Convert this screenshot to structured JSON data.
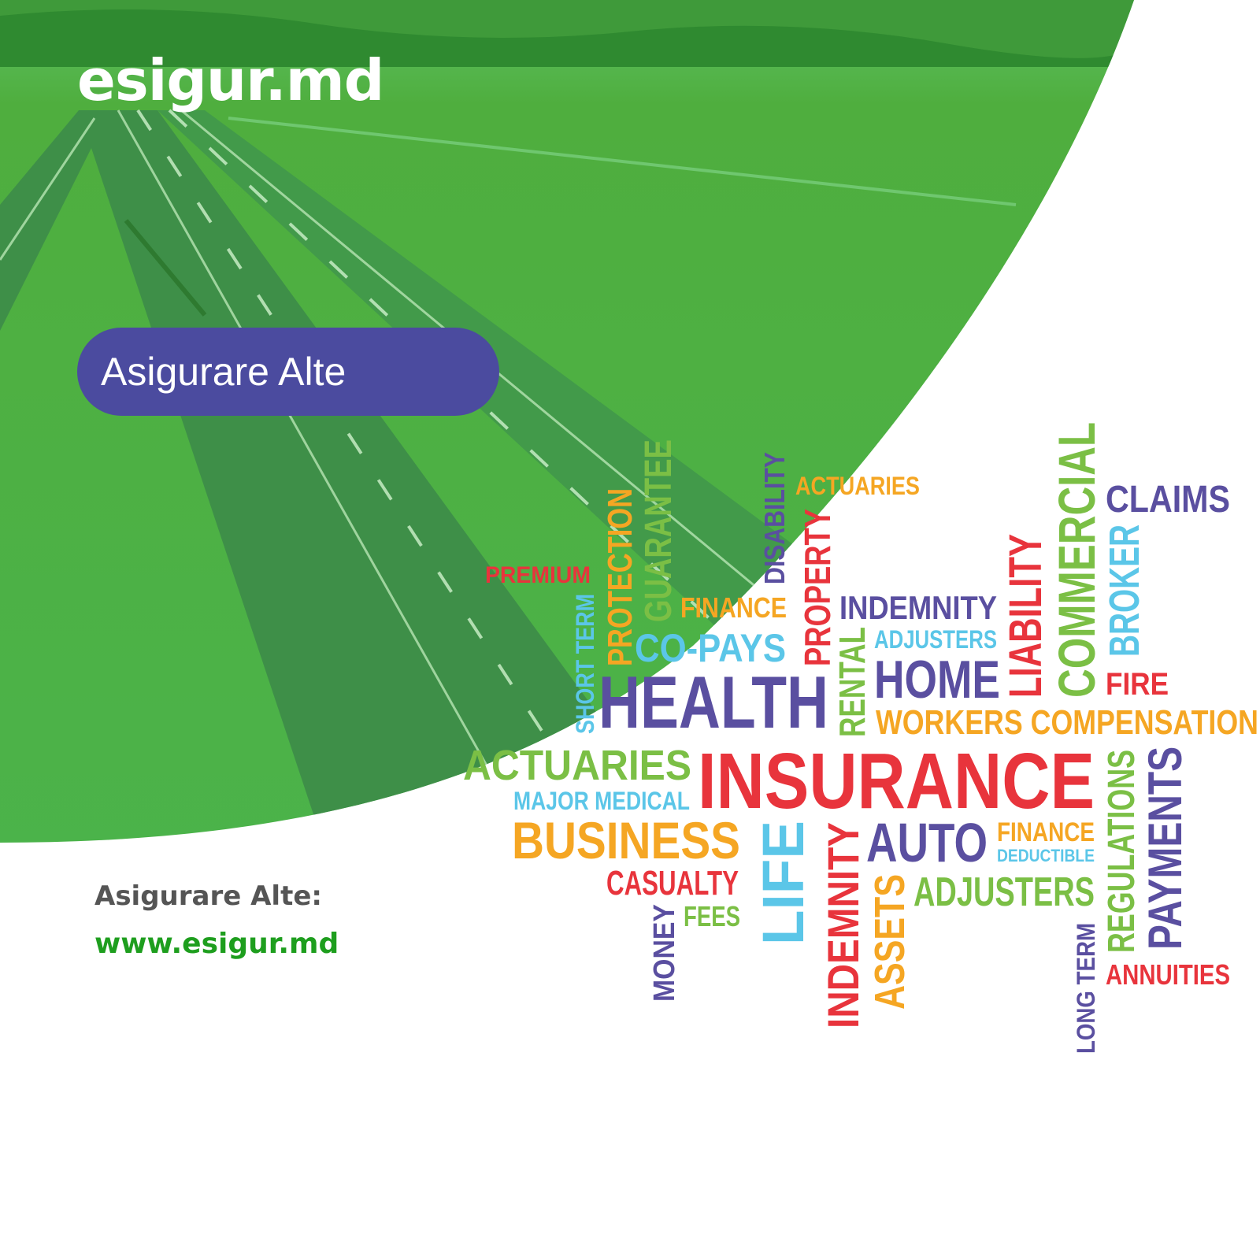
{
  "brand": {
    "logo_text": "esigur.md"
  },
  "banner": {
    "pill_text": "Asigurare Alte"
  },
  "footer": {
    "label": "Asigurare Alte:",
    "url": "www.esigur.md"
  },
  "colors": {
    "green_overlay": "#4CB84C",
    "pill": "#4B4B9F",
    "url_green": "#1E9E1E",
    "label_gray": "#555555"
  },
  "word_cloud": {
    "words": [
      {
        "text": "PREMIUM",
        "color": "#E8343C"
      },
      {
        "text": "SHORT TERM",
        "color": "#5BC6E8"
      },
      {
        "text": "PROTECTION",
        "color": "#F5A623"
      },
      {
        "text": "GUARANTEE",
        "color": "#7BBF45"
      },
      {
        "text": "DISABILITY",
        "color": "#5A4FA0"
      },
      {
        "text": "ACTUARIES",
        "color": "#F5A623"
      },
      {
        "text": "PROPERTY",
        "color": "#E8343C"
      },
      {
        "text": "FINANCE",
        "color": "#F5A623"
      },
      {
        "text": "INDEMNITY",
        "color": "#5A4FA0"
      },
      {
        "text": "CO-PAYS",
        "color": "#5BC6E8"
      },
      {
        "text": "ADJUSTERS",
        "color": "#5BC6E8"
      },
      {
        "text": "RENTAL",
        "color": "#7BBF45"
      },
      {
        "text": "HEALTH",
        "color": "#5A4FA0"
      },
      {
        "text": "HOME",
        "color": "#5A4FA0"
      },
      {
        "text": "LIABILITY",
        "color": "#E8343C"
      },
      {
        "text": "COMMERCIAL",
        "color": "#7BBF45"
      },
      {
        "text": "CLAIMS",
        "color": "#5A4FA0"
      },
      {
        "text": "BROKER",
        "color": "#5BC6E8"
      },
      {
        "text": "FIRE",
        "color": "#E8343C"
      },
      {
        "text": "WORKERS COMPENSATION",
        "color": "#F5A623"
      },
      {
        "text": "ACTUARIES",
        "color": "#7BBF45"
      },
      {
        "text": "INSURANCE",
        "color": "#E8343C"
      },
      {
        "text": "MAJOR MEDICAL",
        "color": "#5BC6E8"
      },
      {
        "text": "BUSINESS",
        "color": "#F5A623"
      },
      {
        "text": "LIFE",
        "color": "#5BC6E8"
      },
      {
        "text": "INDEMNITY",
        "color": "#E8343C"
      },
      {
        "text": "AUTO",
        "color": "#5A4FA0"
      },
      {
        "text": "FINANCE",
        "color": "#F5A623"
      },
      {
        "text": "DEDUCTIBLE",
        "color": "#5BC6E8"
      },
      {
        "text": "CASUALTY",
        "color": "#E8343C"
      },
      {
        "text": "FEES",
        "color": "#7BBF45"
      },
      {
        "text": "MONEY",
        "color": "#5A4FA0"
      },
      {
        "text": "ASSETS",
        "color": "#F5A623"
      },
      {
        "text": "ADJUSTERS",
        "color": "#7BBF45"
      },
      {
        "text": "LONG TERM",
        "color": "#5A4FA0"
      },
      {
        "text": "REGULATIONS",
        "color": "#7BBF45"
      },
      {
        "text": "PAYMENTS",
        "color": "#5A4FA0"
      },
      {
        "text": "ANNUITIES",
        "color": "#E8343C"
      }
    ]
  }
}
